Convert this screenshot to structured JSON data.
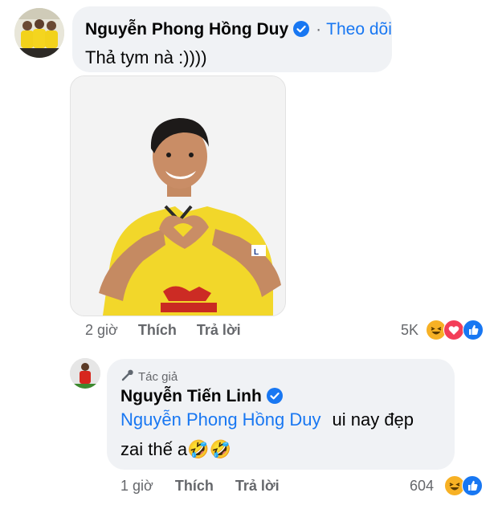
{
  "comment1": {
    "author": "Nguyễn Phong Hồng Duy",
    "follow_label": "Theo dõi",
    "text": "Thả tym nà  :))))",
    "time": "2 giờ",
    "like_label": "Thích",
    "reply_label": "Trả lời",
    "reaction_count": "5K",
    "reactions": [
      "haha-icon",
      "love-icon",
      "like-icon"
    ]
  },
  "comment2": {
    "author_tag": "Tác giả",
    "author": "Nguyễn Tiến Linh",
    "mention": "Nguyễn Phong Hồng Duy",
    "text_line1": "ui nay đẹp",
    "text_line2": "zai thế a🤣🤣",
    "time": "1 giờ",
    "like_label": "Thích",
    "reply_label": "Trả lời",
    "reaction_count": "604",
    "reactions": [
      "haha-icon",
      "like-icon"
    ]
  },
  "colors": {
    "link": "#1877f2",
    "bubble": "#f0f2f5",
    "muted": "#65676b",
    "love": "#f33e58",
    "haha": "#f7b125"
  }
}
